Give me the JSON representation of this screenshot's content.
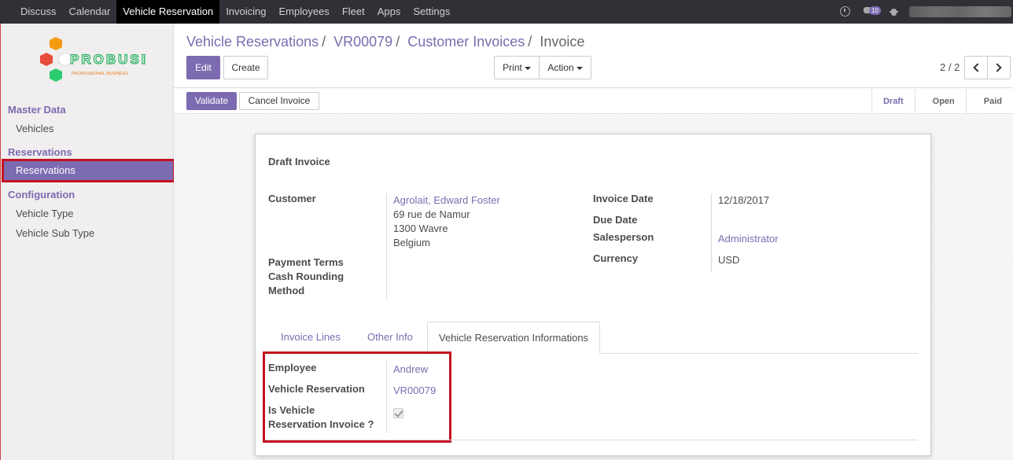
{
  "topnav": {
    "items": [
      "Discuss",
      "Calendar",
      "Vehicle Reservation",
      "Invoicing",
      "Employees",
      "Fleet",
      "Apps",
      "Settings"
    ],
    "active": "Vehicle Reservation",
    "messages_count": "10"
  },
  "logo": {
    "name": "PROBUSE",
    "tagline": "PROFESSIONAL BUSINESS"
  },
  "sidebar": {
    "sections": [
      {
        "title": "Master Data",
        "items": [
          "Vehicles"
        ]
      },
      {
        "title": "Reservations",
        "items": [
          "Reservations"
        ]
      },
      {
        "title": "Configuration",
        "items": [
          "Vehicle Type",
          "Vehicle Sub Type"
        ]
      }
    ]
  },
  "breadcrumb": {
    "items": [
      "Vehicle Reservations",
      "VR00079",
      "Customer Invoices"
    ],
    "current": "Invoice"
  },
  "toolbar": {
    "edit": "Edit",
    "create": "Create",
    "print": "Print",
    "action": "Action",
    "pager": "2 / 2"
  },
  "statusbar": {
    "validate": "Validate",
    "cancel": "Cancel Invoice",
    "stages": [
      "Draft",
      "Open",
      "Paid"
    ],
    "active_stage": "Draft"
  },
  "form": {
    "title": "Draft Invoice",
    "customer_label": "Customer",
    "customer_name": "Agrolait, Edward Foster",
    "address": [
      "69 rue de Namur",
      "1300 Wavre",
      "Belgium"
    ],
    "payment_terms_label": "Payment Terms",
    "cash_rounding_label": [
      "Cash Rounding",
      "Method"
    ],
    "invoice_date_label": "Invoice Date",
    "invoice_date": "12/18/2017",
    "due_date_label": "Due Date",
    "salesperson_label": "Salesperson",
    "salesperson": "Administrator",
    "currency_label": "Currency",
    "currency": "USD"
  },
  "tabs": [
    "Invoice Lines",
    "Other Info",
    "Vehicle Reservation Informations"
  ],
  "active_tab": "Vehicle Reservation Informations",
  "reservation_info": {
    "employee_label": "Employee",
    "employee": "Andrew",
    "reservation_label": "Vehicle Reservation",
    "reservation": "VR00079",
    "is_invoice_label": [
      "Is Vehicle",
      "Reservation Invoice ?"
    ],
    "is_invoice": true
  },
  "colors": {
    "accent": "#7c6bb1",
    "highlight": "#c41220",
    "topbar": "#2f3136"
  }
}
